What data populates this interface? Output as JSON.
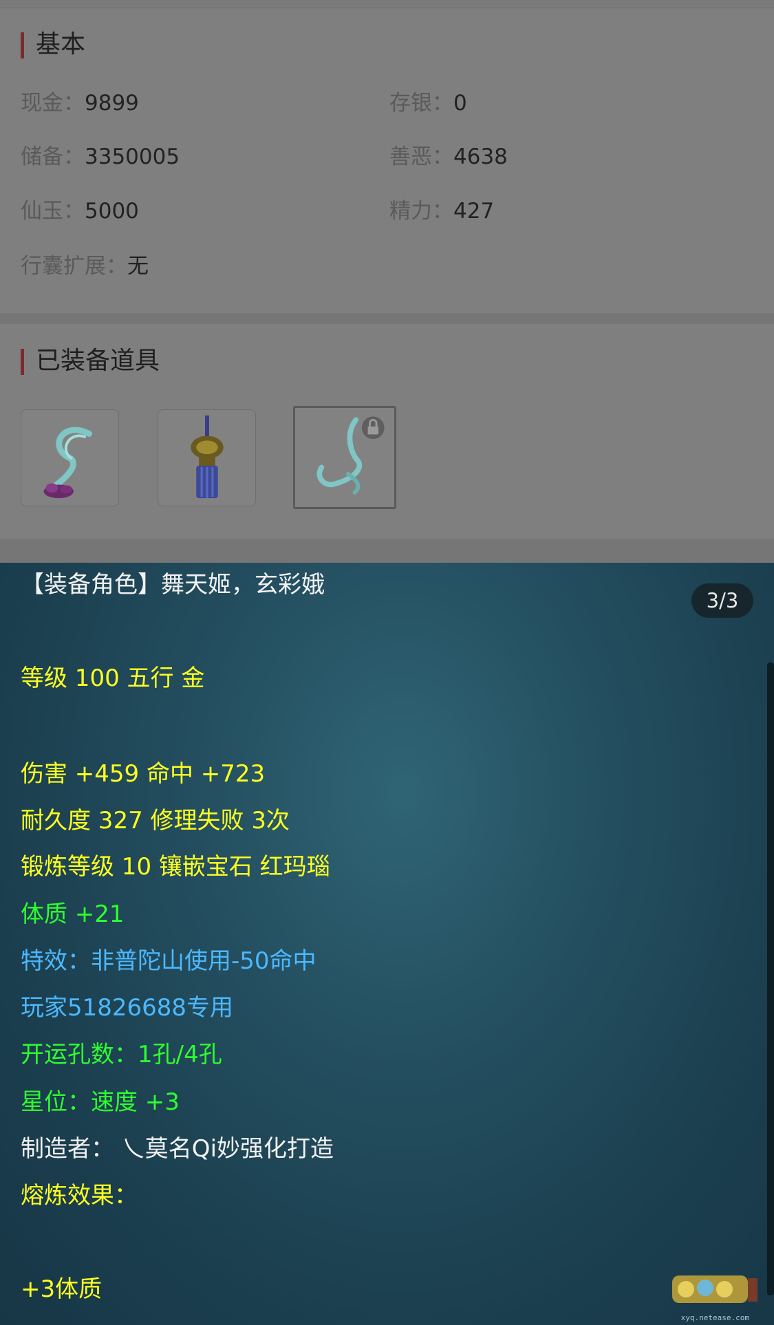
{
  "basic": {
    "title": "基本",
    "rows": [
      {
        "left": {
          "label": "现金：",
          "value": "9899"
        },
        "right": {
          "label": "存银：",
          "value": "0"
        }
      },
      {
        "left": {
          "label": "储备：",
          "value": "3350005"
        },
        "right": {
          "label": "善恶：",
          "value": "4638"
        }
      },
      {
        "left": {
          "label": "仙玉：",
          "value": "5000"
        },
        "right": {
          "label": "精力：",
          "value": "427"
        }
      }
    ],
    "expand": {
      "label": "行囊扩展：",
      "value": "无"
    }
  },
  "equipped": {
    "title": "已装备道具",
    "items": [
      {
        "icon": "cyan-ribbon-purple-pendant-icon"
      },
      {
        "icon": "blue-tassel-gold-knot-icon"
      },
      {
        "icon": "cyan-ribbon-locked-icon",
        "locked": true,
        "selected": true
      }
    ]
  },
  "tooltip": {
    "counter": "3/3",
    "lines": [
      {
        "text": "【装备角色】舞天姬，玄彩娥",
        "color": "white"
      },
      {
        "text": "等级 100 五行 金",
        "color": "yellow"
      },
      {
        "text": "伤害 +459 命中 +723",
        "color": "yellow"
      },
      {
        "text": "耐久度 327 修理失败 3次",
        "color": "yellow"
      },
      {
        "text": "锻炼等级 10 镶嵌宝石 红玛瑙",
        "color": "yellow"
      },
      {
        "text": "体质 +21",
        "color": "green"
      },
      {
        "text": "特效：非普陀山使用-50命中",
        "color": "blue"
      },
      {
        "text": "玩家51826688专用",
        "color": "blue"
      },
      {
        "text": "开运孔数：1孔/4孔",
        "color": "green"
      },
      {
        "text": "星位：速度 +3",
        "color": "green"
      },
      {
        "text": "制造者：  乀莫名Qi妙强化打造",
        "color": "white"
      },
      {
        "text": "熔炼效果：",
        "color": "yellow"
      },
      {
        "text": "+3体质",
        "color": "yellow"
      }
    ]
  },
  "watermark": {
    "domain": "xyq.netease.com"
  },
  "colors": {
    "white": "#f2f2f2",
    "yellow": "#ffff20",
    "green": "#2eff2e",
    "blue": "#4cb8ff",
    "accent": "#7a2c2c"
  }
}
